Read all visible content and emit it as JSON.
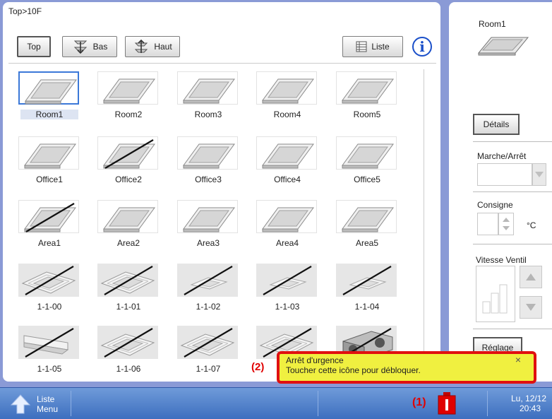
{
  "breadcrumb": "Top>10F",
  "toolbar": {
    "top_label": "Top",
    "bas_label": "Bas",
    "haut_label": "Haut",
    "liste_label": "Liste",
    "info_glyph": "i"
  },
  "grid": {
    "selected_item": "Room1",
    "rows": [
      [
        {
          "label": "Room1",
          "icon": "room-icon",
          "crossed": false
        },
        {
          "label": "Room2",
          "icon": "room-icon",
          "crossed": false
        },
        {
          "label": "Room3",
          "icon": "room-icon",
          "crossed": false
        },
        {
          "label": "Room4",
          "icon": "room-icon",
          "crossed": false
        },
        {
          "label": "Room5",
          "icon": "room-icon",
          "crossed": false
        }
      ],
      [
        {
          "label": "Office1",
          "icon": "room-icon",
          "crossed": false
        },
        {
          "label": "Office2",
          "icon": "room-icon",
          "crossed": true
        },
        {
          "label": "Office3",
          "icon": "room-icon",
          "crossed": false
        },
        {
          "label": "Office4",
          "icon": "room-icon",
          "crossed": false
        },
        {
          "label": "Office5",
          "icon": "room-icon",
          "crossed": false
        }
      ],
      [
        {
          "label": "Area1",
          "icon": "room-icon",
          "crossed": true
        },
        {
          "label": "Area2",
          "icon": "room-icon",
          "crossed": false
        },
        {
          "label": "Area3",
          "icon": "room-icon",
          "crossed": false
        },
        {
          "label": "Area4",
          "icon": "room-icon",
          "crossed": false
        },
        {
          "label": "Area5",
          "icon": "room-icon",
          "crossed": false
        }
      ],
      [
        {
          "label": "1-1-00",
          "icon": "cassette-unit-icon",
          "crossed": true
        },
        {
          "label": "1-1-01",
          "icon": "cassette-unit-icon",
          "crossed": true
        },
        {
          "label": "1-1-02",
          "icon": "ceiling-unit-icon",
          "crossed": true
        },
        {
          "label": "1-1-03",
          "icon": "ceiling-unit-icon",
          "crossed": true
        },
        {
          "label": "1-1-04",
          "icon": "ceiling-unit-icon",
          "crossed": true
        }
      ],
      [
        {
          "label": "1-1-05",
          "icon": "wall-unit-icon",
          "crossed": true
        },
        {
          "label": "1-1-06",
          "icon": "cassette-unit-icon",
          "crossed": true
        },
        {
          "label": "1-1-07",
          "icon": "cassette-unit-icon",
          "crossed": true
        },
        {
          "label": "",
          "icon": "cassette-unit-icon",
          "crossed": true
        },
        {
          "label": "",
          "icon": "ventilation-unit-icon",
          "crossed": true
        }
      ]
    ]
  },
  "right_panel": {
    "title": "Room1",
    "details_label": "Détails",
    "on_off_label": "Marche/Arrêt",
    "setpoint_label": "Consigne",
    "setpoint_unit": "°C",
    "fan_speed_label": "Vitesse Ventil",
    "settings_label": "Réglage"
  },
  "popup": {
    "marker": "(2)",
    "title": "Arrêt d'urgence",
    "message": "Toucher cette icône pour débloquer.",
    "close_glyph": "×"
  },
  "taskbar": {
    "menu_line1": "Liste",
    "menu_line2": "Menu",
    "alarm_marker": "(1)",
    "date": "Lu, 12/12",
    "time": "20:43"
  },
  "colors": {
    "background": "#8a9ad6",
    "selection_border": "#3b78d8",
    "popup_bg": "#f0f040",
    "popup_border": "#e01010",
    "marker_red": "#e00000",
    "taskbar": "#3d6fbf"
  }
}
